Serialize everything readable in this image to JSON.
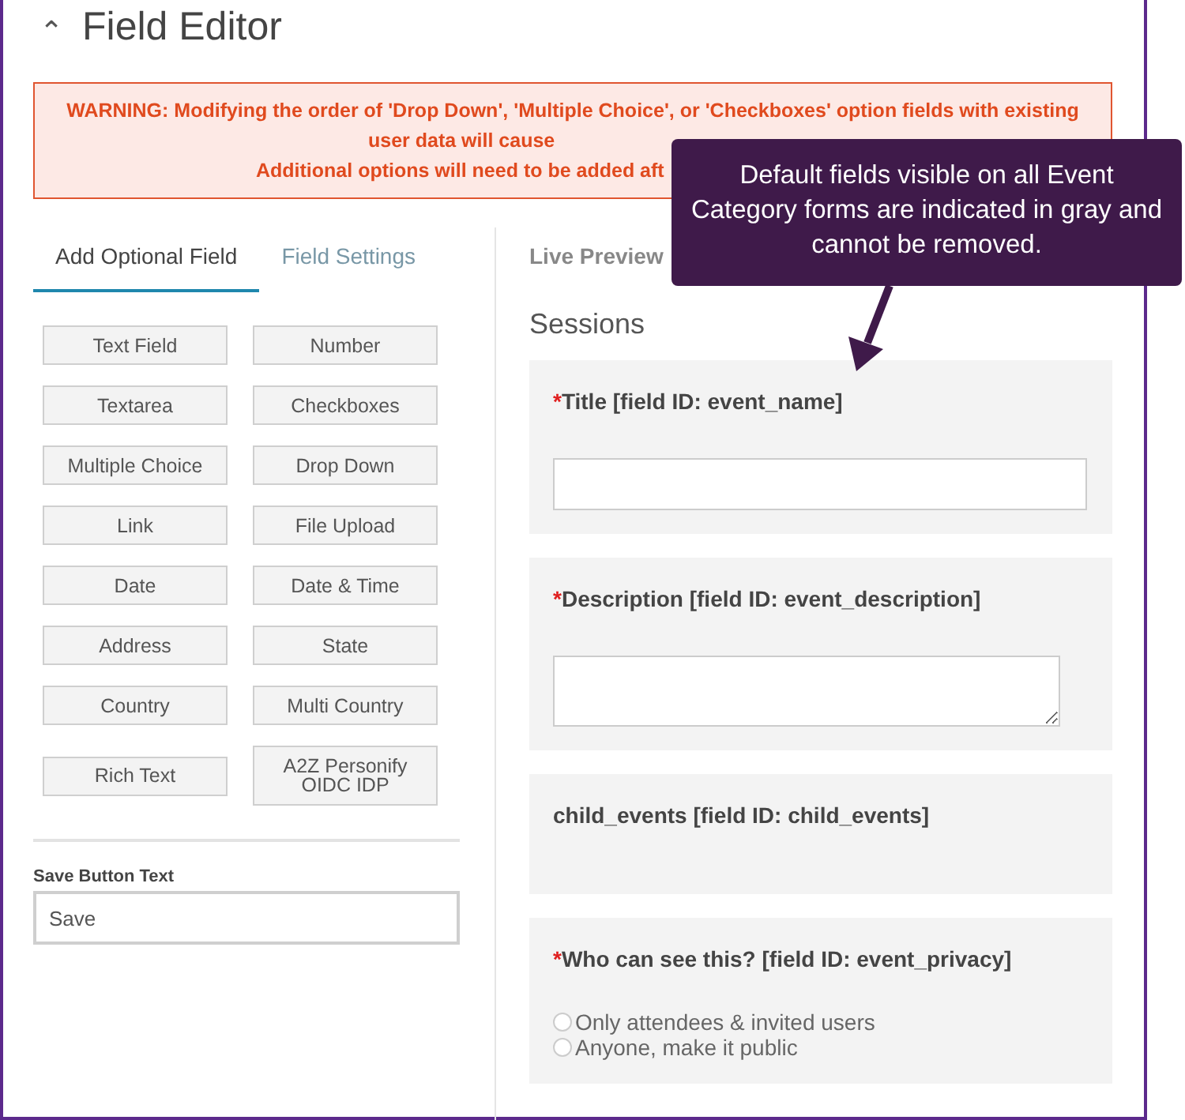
{
  "header": {
    "collapse_icon": "⌃",
    "title": "Field Editor"
  },
  "warning": {
    "lines": [
      "WARNING: Modifying the order of 'Drop Down', 'Multiple Choice', or 'Checkboxes' option fields with existing",
      "user data will cause",
      "Additional options will need to be added aft"
    ]
  },
  "tabs": [
    {
      "label": "Add Optional Field",
      "selected": true
    },
    {
      "label": "Field Settings",
      "selected": false
    }
  ],
  "field_buttons": [
    "Text Field",
    "Number",
    "Textarea",
    "Checkboxes",
    "Multiple Choice",
    "Drop Down",
    "Link",
    "File Upload",
    "Date",
    "Date & Time",
    "Address",
    "State",
    "Country",
    "Multi Country",
    "Rich Text",
    "A2Z Personify OIDC IDP"
  ],
  "save_button_text": {
    "label": "Save Button Text",
    "value": "Save"
  },
  "preview": {
    "heading": "Live Preview",
    "section": "Sessions",
    "required_marker": "*",
    "fields": [
      {
        "kind": "input",
        "required": true,
        "label": "Title [field ID: event_name]"
      },
      {
        "kind": "textarea",
        "required": true,
        "label": "Description [field ID: event_description]"
      },
      {
        "kind": "none",
        "required": false,
        "label": "child_events [field ID: child_events]"
      },
      {
        "kind": "radio",
        "required": true,
        "label": "Who can see this? [field ID: event_privacy]",
        "options": [
          {
            "label": "Only attendees & invited users",
            "selected": false
          },
          {
            "label": "Anyone, make it public",
            "selected": false
          }
        ]
      }
    ]
  },
  "callout": {
    "text": "Default fields visible on all Event Category forms are indicated in gray and cannot be removed."
  }
}
